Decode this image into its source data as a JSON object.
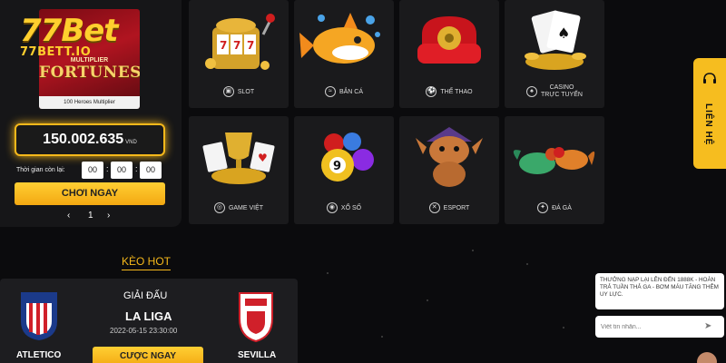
{
  "brand": {
    "logo_main": "77Bet",
    "logo_domain": "77BETT.IO"
  },
  "promo": {
    "game_title_top": "MULTIPLIER",
    "game_title": "FORTUNES",
    "game_caption": "100 Heroes Multiplier",
    "balance": "150.002.635",
    "balance_unit": "VND",
    "timer_label": "Thời gian còn lại:",
    "timer": [
      "00",
      "00",
      "00"
    ],
    "play_button": "CHƠI NGAY",
    "page_prev": "‹",
    "page_current": "1",
    "page_next": "›"
  },
  "games": [
    {
      "label": "SLOT",
      "icon": "slot-icon"
    },
    {
      "label": "BẮN CÁ",
      "icon": "fish-icon"
    },
    {
      "label": "THỂ THAO",
      "icon": "sports-icon"
    },
    {
      "label": "CASINO",
      "label2": "TRỰC TUYẾN",
      "icon": "cards-icon"
    },
    {
      "label": "GAME VIỆT",
      "icon": "game-icon"
    },
    {
      "label": "XỔ SỐ",
      "icon": "lottery-icon"
    },
    {
      "label": "ESPORT",
      "icon": "esport-icon"
    },
    {
      "label": "ĐÁ GÀ",
      "icon": "cockfight-icon"
    }
  ],
  "side_tab": {
    "label": "LIÊN HỆ"
  },
  "hot": {
    "title": "KÈO HOT",
    "league_header": "GIẢI ĐẤU",
    "league": "LA LIGA",
    "datetime": "2022-05-15 23:30:00",
    "home_team": "ATLETICO",
    "away_team": "SEVILLA",
    "bet_button": "CƯỢC NGAY"
  },
  "chat": {
    "message": "THƯỞNG NẠP LẠI LÊN ĐẾN 1888K - HOÀN TRẢ TUẦN THẢ GA - BƠM MÁU TĂNG THÊM UY LỰC.",
    "input_placeholder": "Viết tin nhắn..."
  },
  "colors": {
    "accent": "#f5b81b",
    "background": "#0b0b0d",
    "tile": "#1a1a1c"
  }
}
